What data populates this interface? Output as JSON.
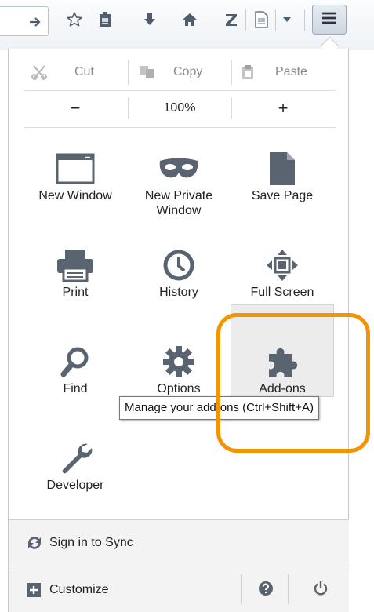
{
  "colors": {
    "highlight": "#f39400",
    "icon_dark": "#5a6370",
    "toolbar_icon": "#4f5d6e"
  },
  "toolbar": {
    "icons": [
      "go-arrow-icon",
      "star-icon",
      "reading-list-icon",
      "download-icon",
      "home-icon",
      "zotero-icon",
      "page-icon",
      "dropdown-icon",
      "hamburger-menu-icon"
    ]
  },
  "edit_controls": {
    "cut_label": "Cut",
    "copy_label": "Copy",
    "paste_label": "Paste"
  },
  "zoom_controls": {
    "zoom_out_label": "−",
    "zoom_level": "100%",
    "zoom_in_label": "+"
  },
  "menu_items": {
    "new_window": "New Window",
    "new_private_window": "New Private Window",
    "save_page": "Save Page",
    "print": "Print",
    "history": "History",
    "full_screen": "Full Screen",
    "find": "Find",
    "options": "Options",
    "add_ons": "Add-ons",
    "developer": "Developer"
  },
  "tooltip": {
    "text": "Manage your add-ons (Ctrl+Shift+A)"
  },
  "footer": {
    "sign_in_label": "Sign in to Sync",
    "customize_label": "Customize"
  }
}
